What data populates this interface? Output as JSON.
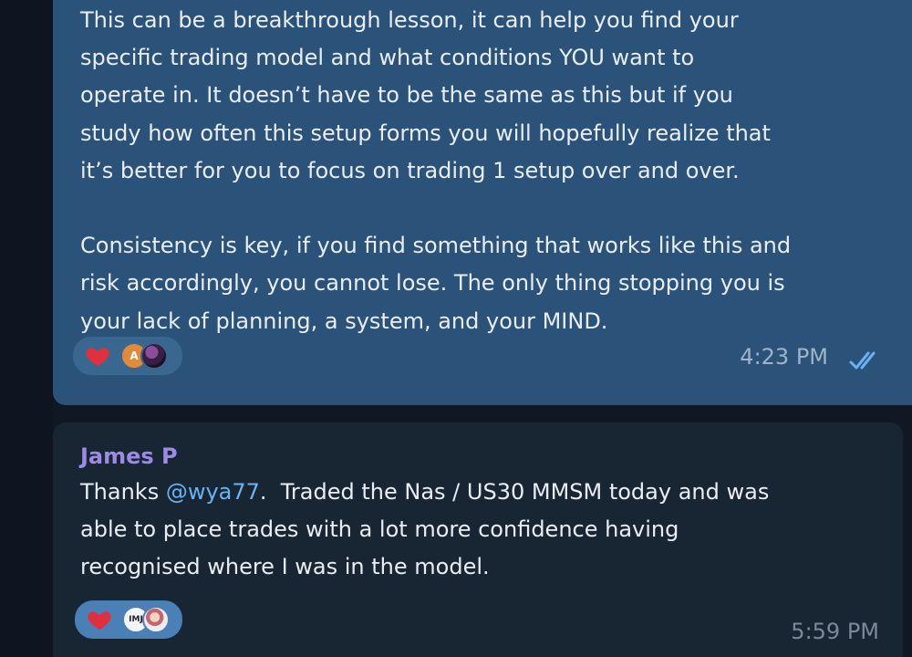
{
  "messages": {
    "outgoing": {
      "text": "This can be a breakthrough lesson, it can help you find your\nspecific trading model and what conditions YOU want to\noperate in. It doesn’t have to be the same as this but if you\nstudy how often this setup forms you will hopefully realize that\nit’s better for you to focus on trading 1 setup over and over.\n\nConsistency is key, if you find something that works like this and\nrisk accordingly, you cannot lose. The only thing stopping you is\nyour lack of planning, a system, and your MIND.",
      "reactions": {
        "emoji": "heart-icon",
        "avatar_letter": "A"
      },
      "time": "4:23 PM",
      "status_icon": "double-check-icon"
    },
    "incoming": {
      "sender": "James P",
      "text_before": "Thanks ",
      "mention": "@wya77",
      "text_after": ".  Traded the Nas / US30 MMSM today and was\nable to place trades with a lot more confidence having\nrecognised where I was in the model.",
      "reactions": {
        "emoji": "heart-icon",
        "avatar_label": "IMJ"
      },
      "time": "5:59 PM"
    }
  },
  "colors": {
    "chat_background": "#0f1823",
    "outgoing_bubble": "#2b5278",
    "incoming_bubble": "#182533",
    "sender_name": "#9d89e6",
    "mention": "#6ab3f3",
    "heart": "#e0303d"
  }
}
